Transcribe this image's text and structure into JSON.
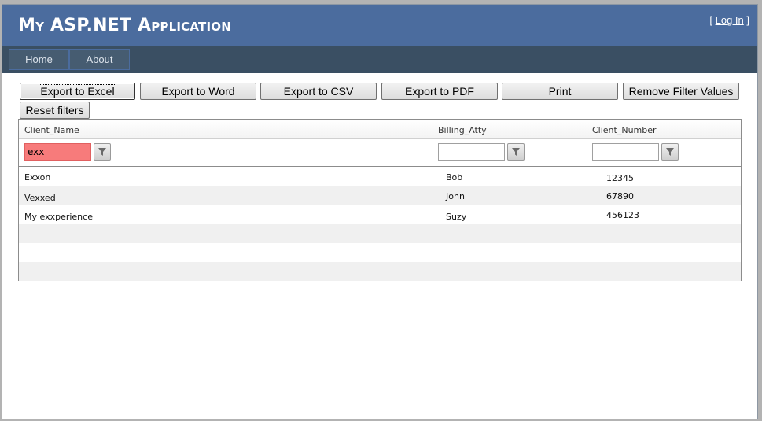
{
  "header": {
    "title": "My ASP.NET Application",
    "login_prefix": "[ ",
    "login_link": "Log In",
    "login_suffix": " ]"
  },
  "menu": {
    "items": [
      {
        "label": "Home"
      },
      {
        "label": "About"
      }
    ]
  },
  "toolbar": {
    "export_excel": "Export to Excel",
    "export_word": "Export to Word",
    "export_csv": "Export to CSV",
    "export_pdf": "Export to PDF",
    "print": "Print",
    "remove_filter_values": "Remove Filter Values",
    "reset_filters": "Reset filters"
  },
  "grid": {
    "columns": [
      {
        "header": "Client_Name"
      },
      {
        "header": "Billing_Atty"
      },
      {
        "header": "Client_Number"
      }
    ],
    "filters": {
      "client_name": "exx",
      "billing_atty": "",
      "client_number": ""
    },
    "rows": [
      {
        "client_name": "Exxon",
        "billing_atty": "Bob",
        "client_number": "12345"
      },
      {
        "client_name": "Vexxed",
        "billing_atty": "John",
        "client_number": "67890"
      },
      {
        "client_name": "My exxperience",
        "billing_atty": "Suzy",
        "client_number": "456123"
      },
      {
        "client_name": "",
        "billing_atty": "",
        "client_number": ""
      },
      {
        "client_name": "",
        "billing_atty": "",
        "client_number": ""
      },
      {
        "client_name": "",
        "billing_atty": "",
        "client_number": ""
      }
    ]
  },
  "icons": {
    "filter": "filter-funnel-icon"
  },
  "colors": {
    "header_bg": "#4b6c9e",
    "menu_bg": "#3a4f63",
    "filter_error_bg": "#f77b7b",
    "row_alt_bg": "#f0f0f0"
  }
}
